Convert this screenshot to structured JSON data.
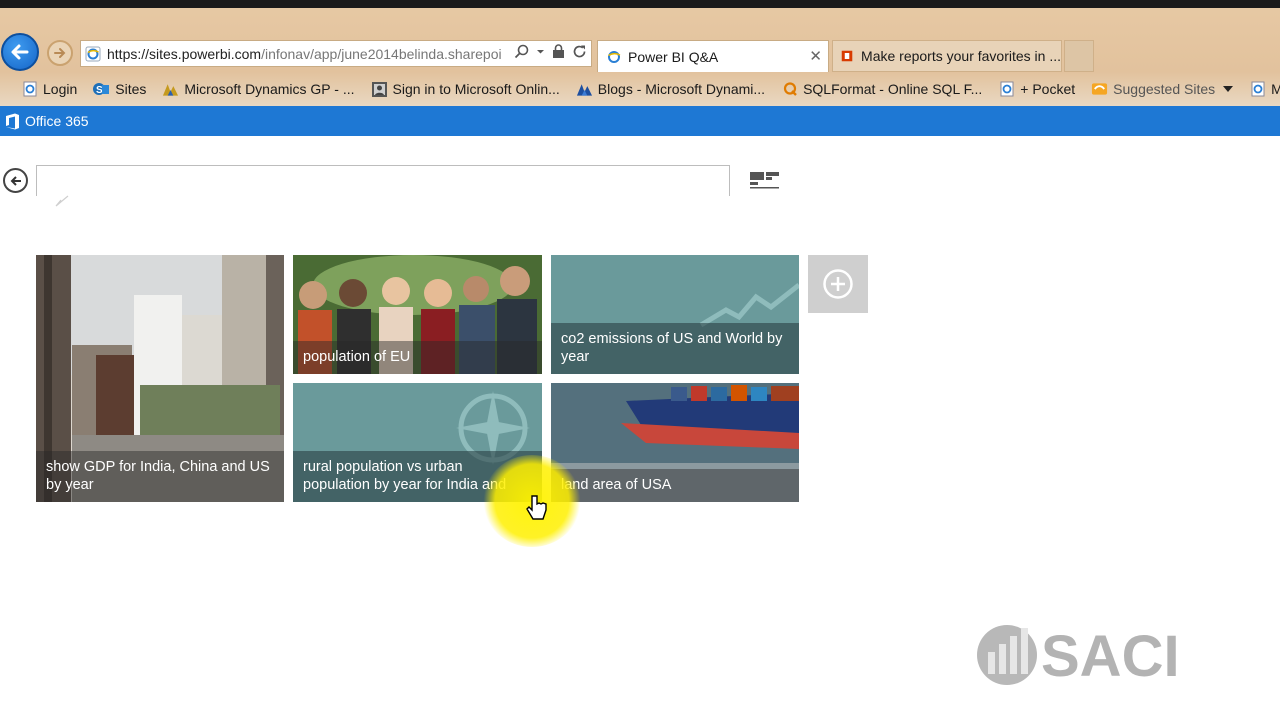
{
  "browser": {
    "url_main": "https://sites.powerbi.com",
    "url_rest": "/infonav/app/june2014belinda.sharepoi",
    "tabs": [
      {
        "label": "Power BI Q&A",
        "active": true
      },
      {
        "label": "Make reports your favorites in ...",
        "active": false
      }
    ],
    "close_glyph": "✕",
    "favorites": [
      {
        "label": "Login",
        "icon": "ie-page-icon"
      },
      {
        "label": "Sites",
        "icon": "sharepoint-icon"
      },
      {
        "label": "Microsoft Dynamics GP - ...",
        "icon": "dynamics-icon"
      },
      {
        "label": "Sign in to Microsoft Onlin...",
        "icon": "photo-icon"
      },
      {
        "label": "Blogs - Microsoft Dynami...",
        "icon": "dynamics-icon"
      },
      {
        "label": "SQLFormat - Online SQL F...",
        "icon": "sqlformat-icon"
      },
      {
        "label": "+ Pocket",
        "icon": "ie-page-icon"
      },
      {
        "label": "Suggested Sites",
        "icon": "suggested-sites-icon"
      },
      {
        "label": "MVP P",
        "icon": "ie-page-icon"
      }
    ]
  },
  "office": {
    "brand": "Office 365",
    "brand_color": "#1e78d4"
  },
  "qa": {
    "input_value": "",
    "tiles": [
      {
        "label": "show GDP for India, China and US by year",
        "image": "city-skyline"
      },
      {
        "label": "population of EU",
        "image": "group-of-people"
      },
      {
        "label": "co2 emissions of US and World by year",
        "image": "line-chart-watermark"
      },
      {
        "label": "rural population vs urban population by year for India and",
        "image": "compass-watermark"
      },
      {
        "label": "land area of USA",
        "image": "container-ship"
      }
    ],
    "add_tile_icon": "plus-circle-icon"
  },
  "watermark": {
    "text": "SACI"
  }
}
